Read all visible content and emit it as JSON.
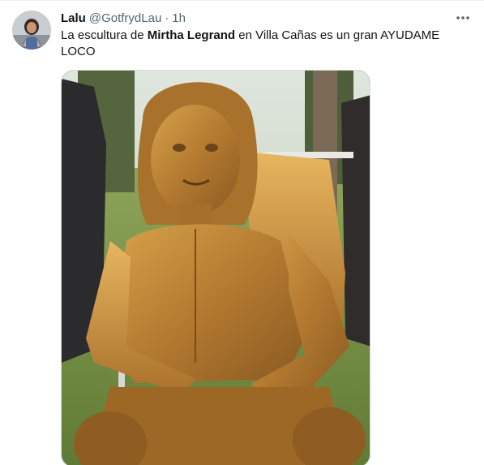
{
  "tweet": {
    "author": {
      "display_name": "Lalu",
      "handle": "@GotfrydLau",
      "avatar_icon": "user-avatar"
    },
    "separator": "·",
    "timestamp": "1h",
    "more_icon": "more-horizontal-icon",
    "text": {
      "part1": "La escultura de ",
      "bold": "Mirtha Legrand",
      "part2": " en Villa Cañas es un gran AYUDAME LOCO"
    },
    "media": {
      "kind": "photo",
      "description_icon": "tweet-photo"
    }
  },
  "colors": {
    "text_primary": "#0f1419",
    "text_secondary": "#536471",
    "border": "#cfd9de",
    "statue_gold": "#b8893a"
  }
}
